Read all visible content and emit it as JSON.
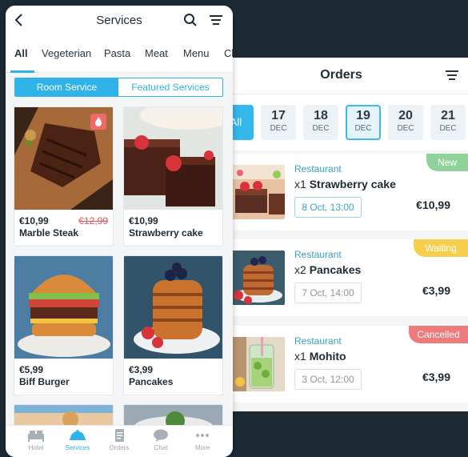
{
  "services": {
    "title": "Services",
    "categories": [
      "All",
      "Vegeterian",
      "Pasta",
      "Meat",
      "Menu",
      "Cl"
    ],
    "segments": {
      "active": "Room Service",
      "inactive": "Featured Services"
    },
    "items": [
      {
        "price": "€10,99",
        "old_price": "€12,99",
        "name": "Marble Steak"
      },
      {
        "price": "€10,99",
        "name": "Strawberry cake"
      },
      {
        "price": "€5,99",
        "name": "Biff Burger"
      },
      {
        "price": "€3,99",
        "name": "Pancakes"
      }
    ],
    "tabbar": [
      {
        "label": "Hotel",
        "icon": "bed-icon"
      },
      {
        "label": "Services",
        "icon": "cloche-icon"
      },
      {
        "label": "Orders",
        "icon": "document-icon"
      },
      {
        "label": "Chat",
        "icon": "chat-bubble-icon"
      },
      {
        "label": "More",
        "icon": "more-dots-icon"
      }
    ]
  },
  "orders": {
    "title": "Orders",
    "dates": [
      {
        "day": "All"
      },
      {
        "day": "17",
        "month": "DEC"
      },
      {
        "day": "18",
        "month": "DEC"
      },
      {
        "day": "19",
        "month": "DEC",
        "selected": true
      },
      {
        "day": "20",
        "month": "DEC"
      },
      {
        "day": "21",
        "month": "DEC"
      }
    ],
    "list": [
      {
        "type": "Restaurant",
        "qty": "x1",
        "name": "Strawberry cake",
        "time": "8 Oct, 13:00",
        "price": "€10,99",
        "status": "New"
      },
      {
        "type": "Restaurant",
        "qty": "x2",
        "name": "Pancakes",
        "time": "7 Oct, 14:00",
        "price": "€3,99",
        "status": "Waiting"
      },
      {
        "type": "Restaurant",
        "qty": "x1",
        "name": "Mohito",
        "time": "3 Oct, 12:00",
        "price": "€3,99",
        "status": "Cancelled"
      }
    ]
  },
  "colors": {
    "accent": "#2fb3e8",
    "new": "#8fd29c",
    "waiting": "#f7cf4c",
    "cancelled": "#ee7b7b",
    "sale": "#e8545a"
  }
}
